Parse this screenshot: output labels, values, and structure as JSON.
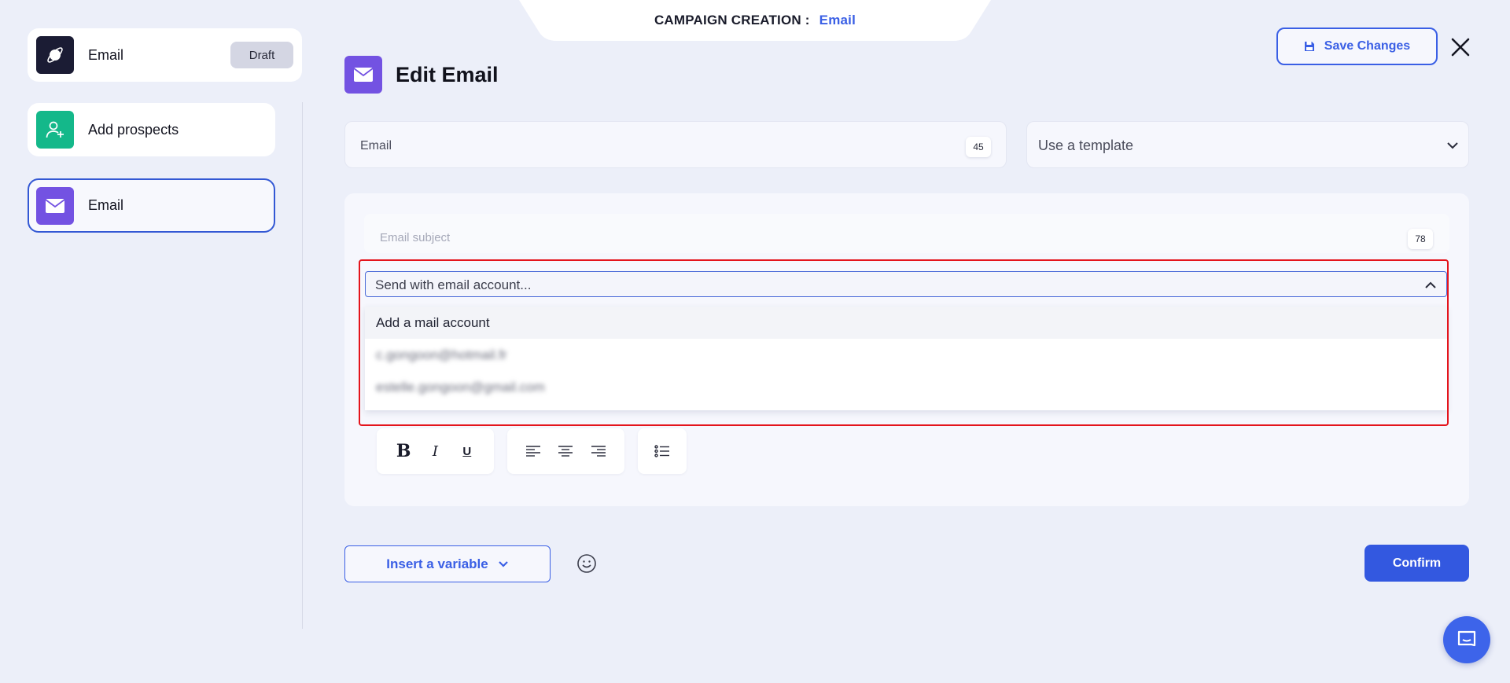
{
  "header": {
    "label": "CAMPAIGN CREATION :",
    "accent": "Email"
  },
  "sidebar": {
    "items": [
      {
        "label": "Email",
        "badge": "Draft",
        "icon": "planet-icon",
        "color": "#1b1c34"
      },
      {
        "label": "Add prospects",
        "icon": "add-user-icon",
        "color": "#14b88a"
      },
      {
        "label": "Email",
        "icon": "envelope-icon",
        "color": "#7352e2"
      }
    ]
  },
  "editor": {
    "title": "Edit Email",
    "save_label": "Save Changes",
    "name_placeholder": "Email",
    "name_counter": "45",
    "template_placeholder": "Use a template",
    "subject_placeholder": "Email subject",
    "subject_counter": "78",
    "account_placeholder": "Send with email account...",
    "dropdown": [
      "Add a mail account",
      "c.gongoon@hotmail.fr",
      "estelle.gongoon@gmail.com"
    ]
  },
  "footer": {
    "insert_variable": "Insert a variable",
    "confirm": "Confirm"
  },
  "colors": {
    "accent": "#3a5fe5",
    "highlight": "#e4141c"
  }
}
